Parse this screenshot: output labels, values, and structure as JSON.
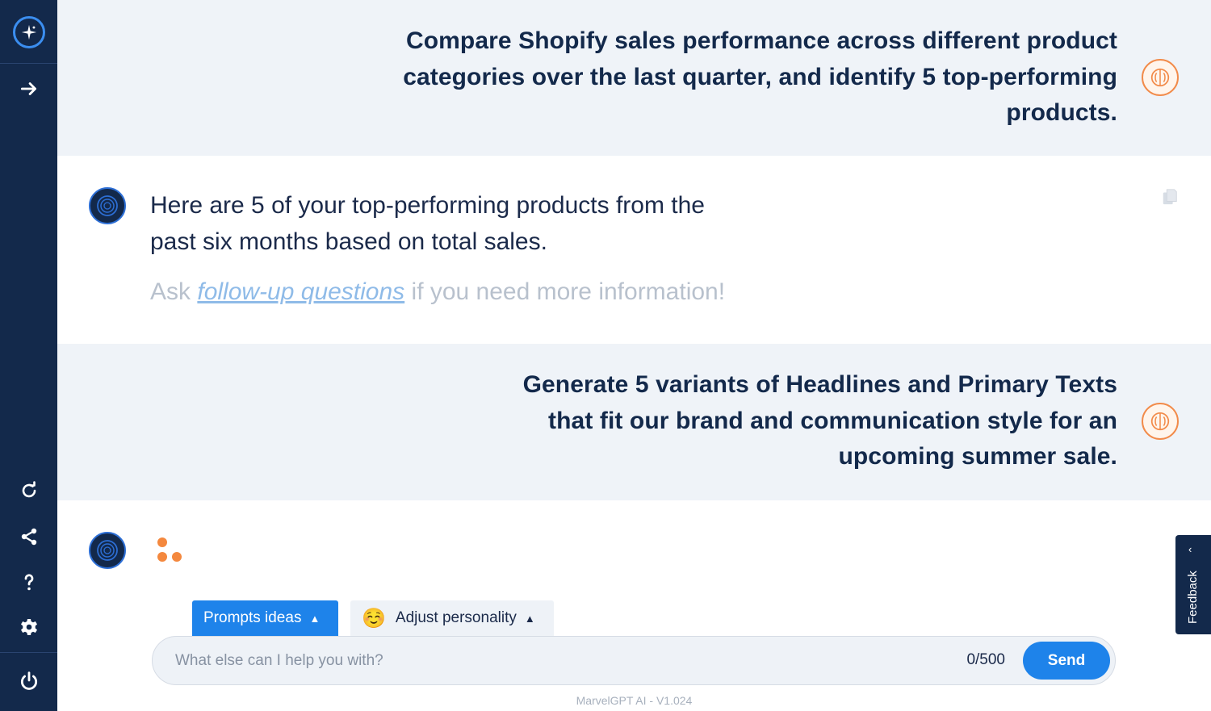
{
  "sidebar": {
    "top_items": [
      "logo-icon",
      "expand-arrow-icon"
    ],
    "bottom_items": [
      "refresh-icon",
      "share-icon",
      "help-icon",
      "settings-icon",
      "power-icon"
    ]
  },
  "conversation": {
    "user_message_1": {
      "lines": [
        "Compare Shopify sales performance across different product",
        "categories over the last quarter, and identify 5 top-performing",
        "products."
      ]
    },
    "bot_message_1": {
      "lines": [
        "Here are 5 of your top-performing products from the",
        "past six months based on total sales."
      ],
      "followup_prefix": "Ask ",
      "followup_link": " follow-up questions",
      "followup_suffix": " if you need more information!"
    },
    "user_message_2": {
      "lines": [
        "Generate 5 variants of Headlines and Primary Texts",
        "that fit our brand and communication style for an",
        "upcoming summer sale."
      ]
    }
  },
  "composer": {
    "prompts_label": "Prompts ideas",
    "personality_emoji": "☺️",
    "personality_label": "Adjust personality",
    "placeholder": "What else can I help you with?",
    "counter": "0/500",
    "send_label": "Send"
  },
  "footer": {
    "version": "MarvelGPT AI - V1.024"
  },
  "feedback": {
    "label": "Feedback"
  },
  "colors": {
    "sidebar": "#13294b",
    "accent": "#1e83ea",
    "user_row": "#eff3f8",
    "user_avatar_ring": "#f28b4a",
    "typing_dots": "#f4883e"
  }
}
